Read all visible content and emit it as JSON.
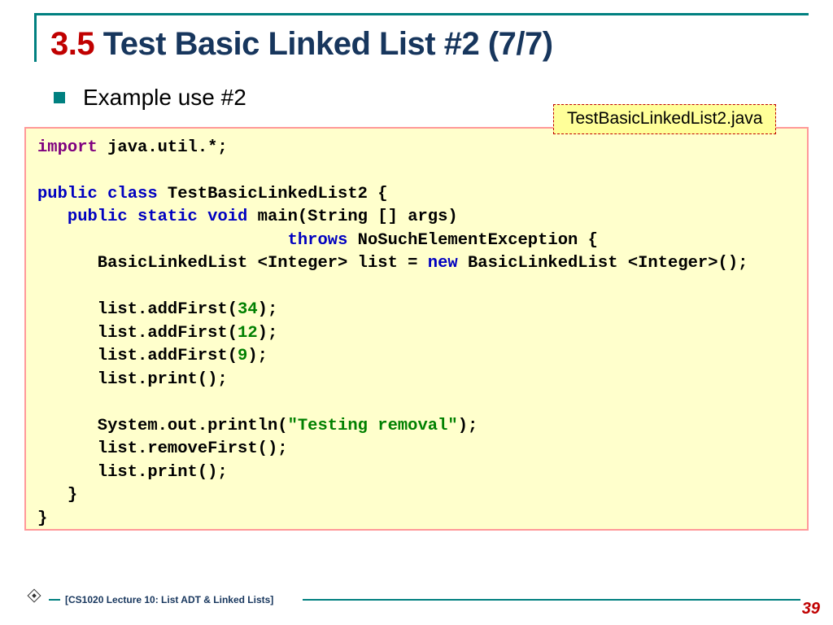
{
  "title": {
    "section_number": "3.5",
    "section_text": " Test Basic Linked List #2 (7/7)"
  },
  "bullet": "Example use #2",
  "filename": "TestBasicLinkedList2.java",
  "code": {
    "import_kw": "import",
    "import_rest": " java.util.*;",
    "l3a": "public",
    "l3b": " class",
    "l3c": " TestBasicLinkedList2 {",
    "l4pad": "   ",
    "l4a": "public",
    "l4b": " static",
    "l4c": " void",
    "l4d": " main(String [] args)",
    "l5pad": "                         ",
    "l5a": "throws",
    "l5b": " NoSuchElementException {",
    "l6a": "      BasicLinkedList <Integer> list = ",
    "l6b": "new",
    "l6c": " BasicLinkedList <Integer>();",
    "l8a": "      list.addFirst(",
    "l8n": "34",
    "l8c": ");",
    "l9a": "      list.addFirst(",
    "l9n": "12",
    "l9c": ");",
    "l10a": "      list.addFirst(",
    "l10n": "9",
    "l10c": ");",
    "l11": "      list.print();",
    "l13a": "      System.out.println(",
    "l13s": "\"Testing removal\"",
    "l13c": ");",
    "l14": "      list.removeFirst();",
    "l15": "      list.print();",
    "l16": "   }",
    "l17": "}"
  },
  "footer": {
    "label": "[CS1020 Lecture 10: List ADT & Linked Lists]",
    "page": "39"
  }
}
